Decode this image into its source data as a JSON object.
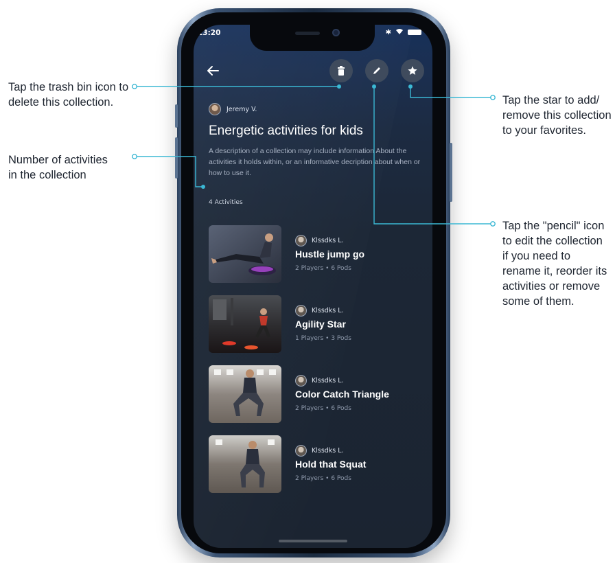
{
  "annotations": [
    "Tap the trash bin icon to delete this collection.",
    "Number of activities in the collection",
    "Tap the star to add/ remove this collection to your favorites.",
    "Tap the \"pencil\" icon to edit the collection if you need to rename it, reorder its activities or remove some of them."
  ],
  "status_bar": {
    "time": "13:20"
  },
  "header": {
    "back_icon": "back-arrow-icon",
    "actions": [
      "trash-icon",
      "pencil-icon",
      "star-icon"
    ]
  },
  "collection": {
    "author": "Jeremy V.",
    "title": "Energetic activities for kids",
    "description": "A description of a collection may include information About the activities it holds within, or an informative decription about when or how to use it.",
    "activity_count": "4 Activities"
  },
  "activities": [
    {
      "author": "Klssdks L.",
      "title": "Hustle jump go",
      "meta": "2 Players • 6 Pods"
    },
    {
      "author": "Klssdks L.",
      "title": "Agility Star",
      "meta": "1 Players • 3 Pods"
    },
    {
      "author": "Klssdks L.",
      "title": "Color Catch Triangle",
      "meta": "2 Players • 6 Pods"
    },
    {
      "author": "Klssdks L.",
      "title": "Hold that Squat",
      "meta": "2 Players • 6 Pods"
    }
  ],
  "colors": {
    "callout_line": "#3bb8d4",
    "screen_bg": "#1c2736",
    "annotation_text": "#1e2530"
  }
}
